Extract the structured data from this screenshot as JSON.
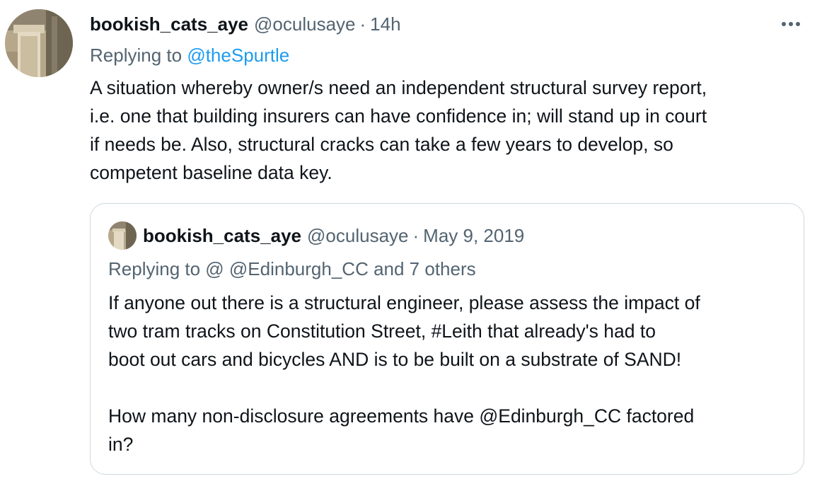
{
  "tweet": {
    "display_name": "bookish_cats_aye",
    "handle": "@oculusaye",
    "separator": "·",
    "time": "14h",
    "replying_prefix": "Replying to",
    "replying_to": "@theSpurtle",
    "body_lines": [
      "A situation whereby owner/s need an independent structural survey report,",
      "i.e. one that building insurers can have confidence in; will stand up in court",
      "if needs be. Also, structural cracks can take a few years to develop, so",
      "competent baseline data key."
    ]
  },
  "quoted_tweet": {
    "display_name": "bookish_cats_aye",
    "handle": "@oculusaye",
    "separator": "·",
    "date": "May 9, 2019",
    "replying_text": "Replying to @ @Edinburgh_CC and 7 others",
    "body_lines": [
      "If anyone out there is a structural engineer, please assess the impact of",
      "two tram tracks on Constitution Street, #Leith that already's had to",
      "boot out cars and bicycles AND is to be built on a substrate of SAND!"
    ],
    "body_lines_2": [
      "How many non-disclosure agreements have @Edinburgh_CC factored",
      "in?"
    ]
  },
  "icons": {
    "more": "more-horizontal-icon",
    "avatar": "avatar-image"
  },
  "colors": {
    "text_primary": "#0f1419",
    "text_secondary": "#536471",
    "link": "#1d9bf0",
    "border": "#cfd9de"
  }
}
